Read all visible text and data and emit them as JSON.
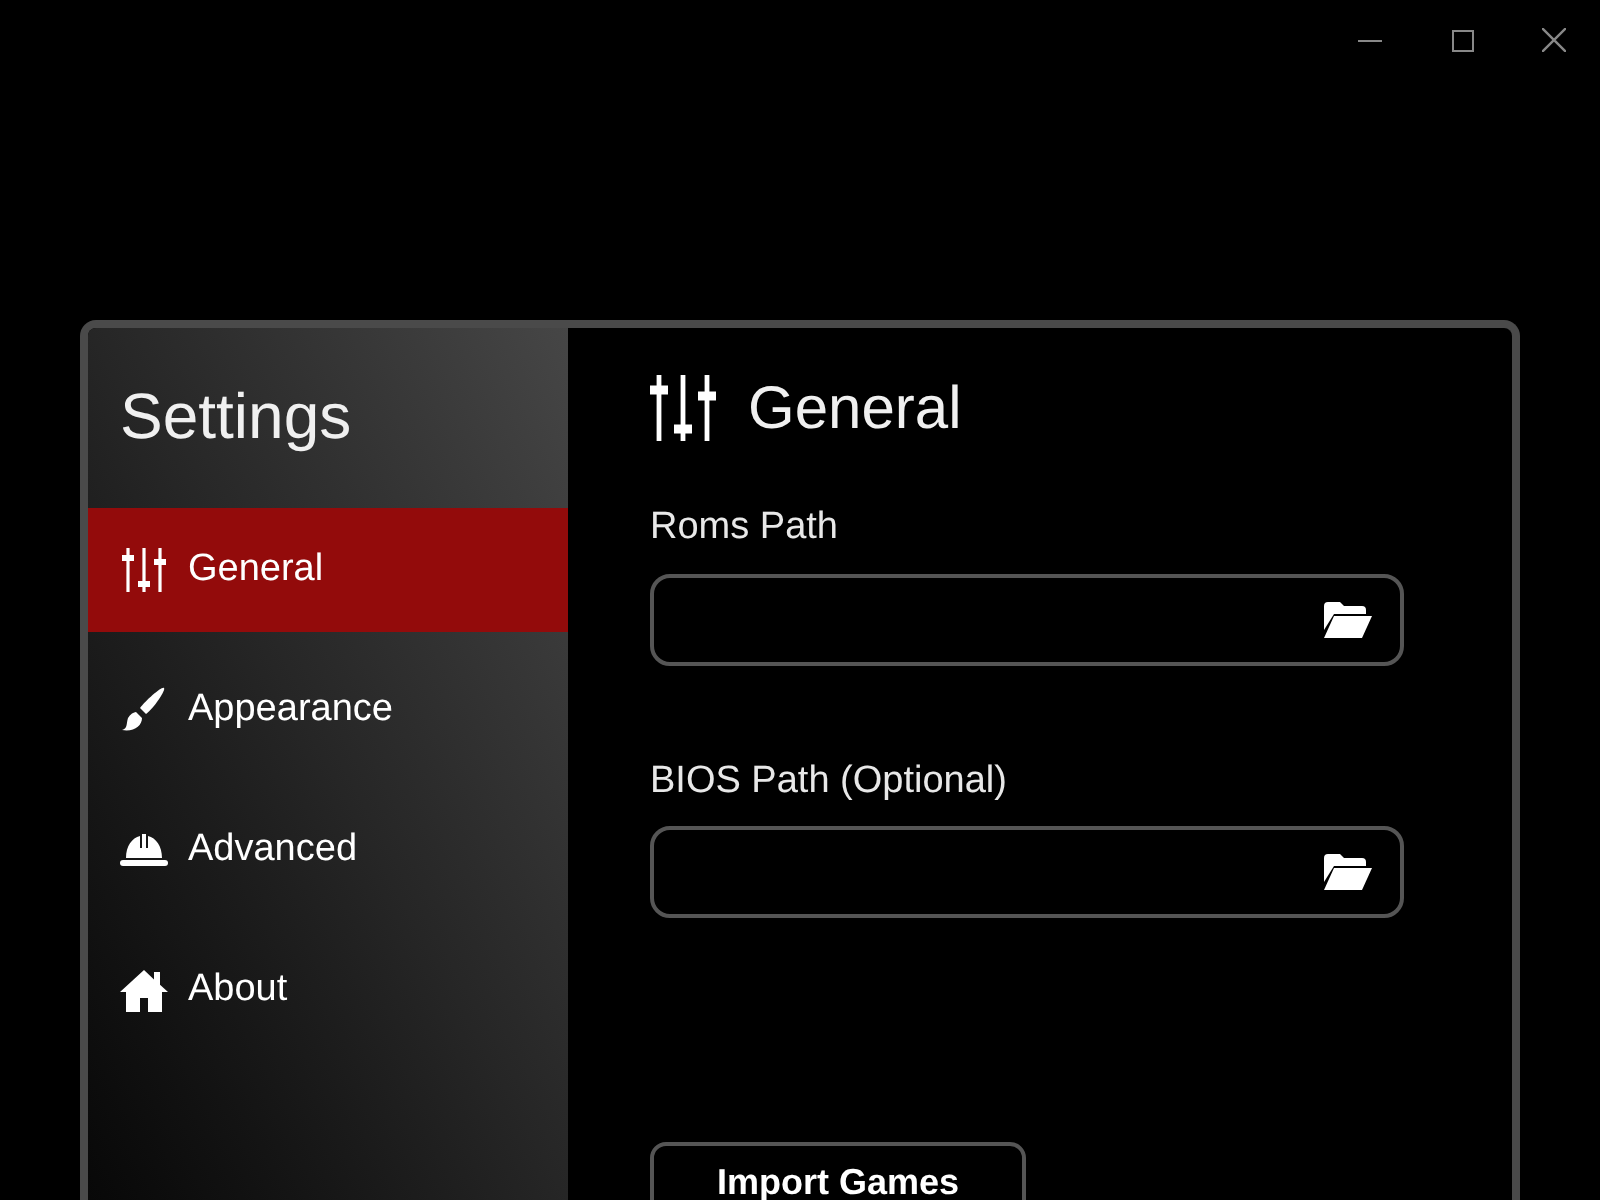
{
  "sidebar": {
    "title": "Settings",
    "items": [
      {
        "label": "General",
        "selected": true
      },
      {
        "label": "Appearance",
        "selected": false
      },
      {
        "label": "Advanced",
        "selected": false
      },
      {
        "label": "About",
        "selected": false
      }
    ]
  },
  "content": {
    "title": "General",
    "fields": [
      {
        "label": "Roms Path"
      },
      {
        "label": "BIOS Path (Optional)"
      }
    ],
    "button": {
      "label": "Import Games"
    }
  }
}
